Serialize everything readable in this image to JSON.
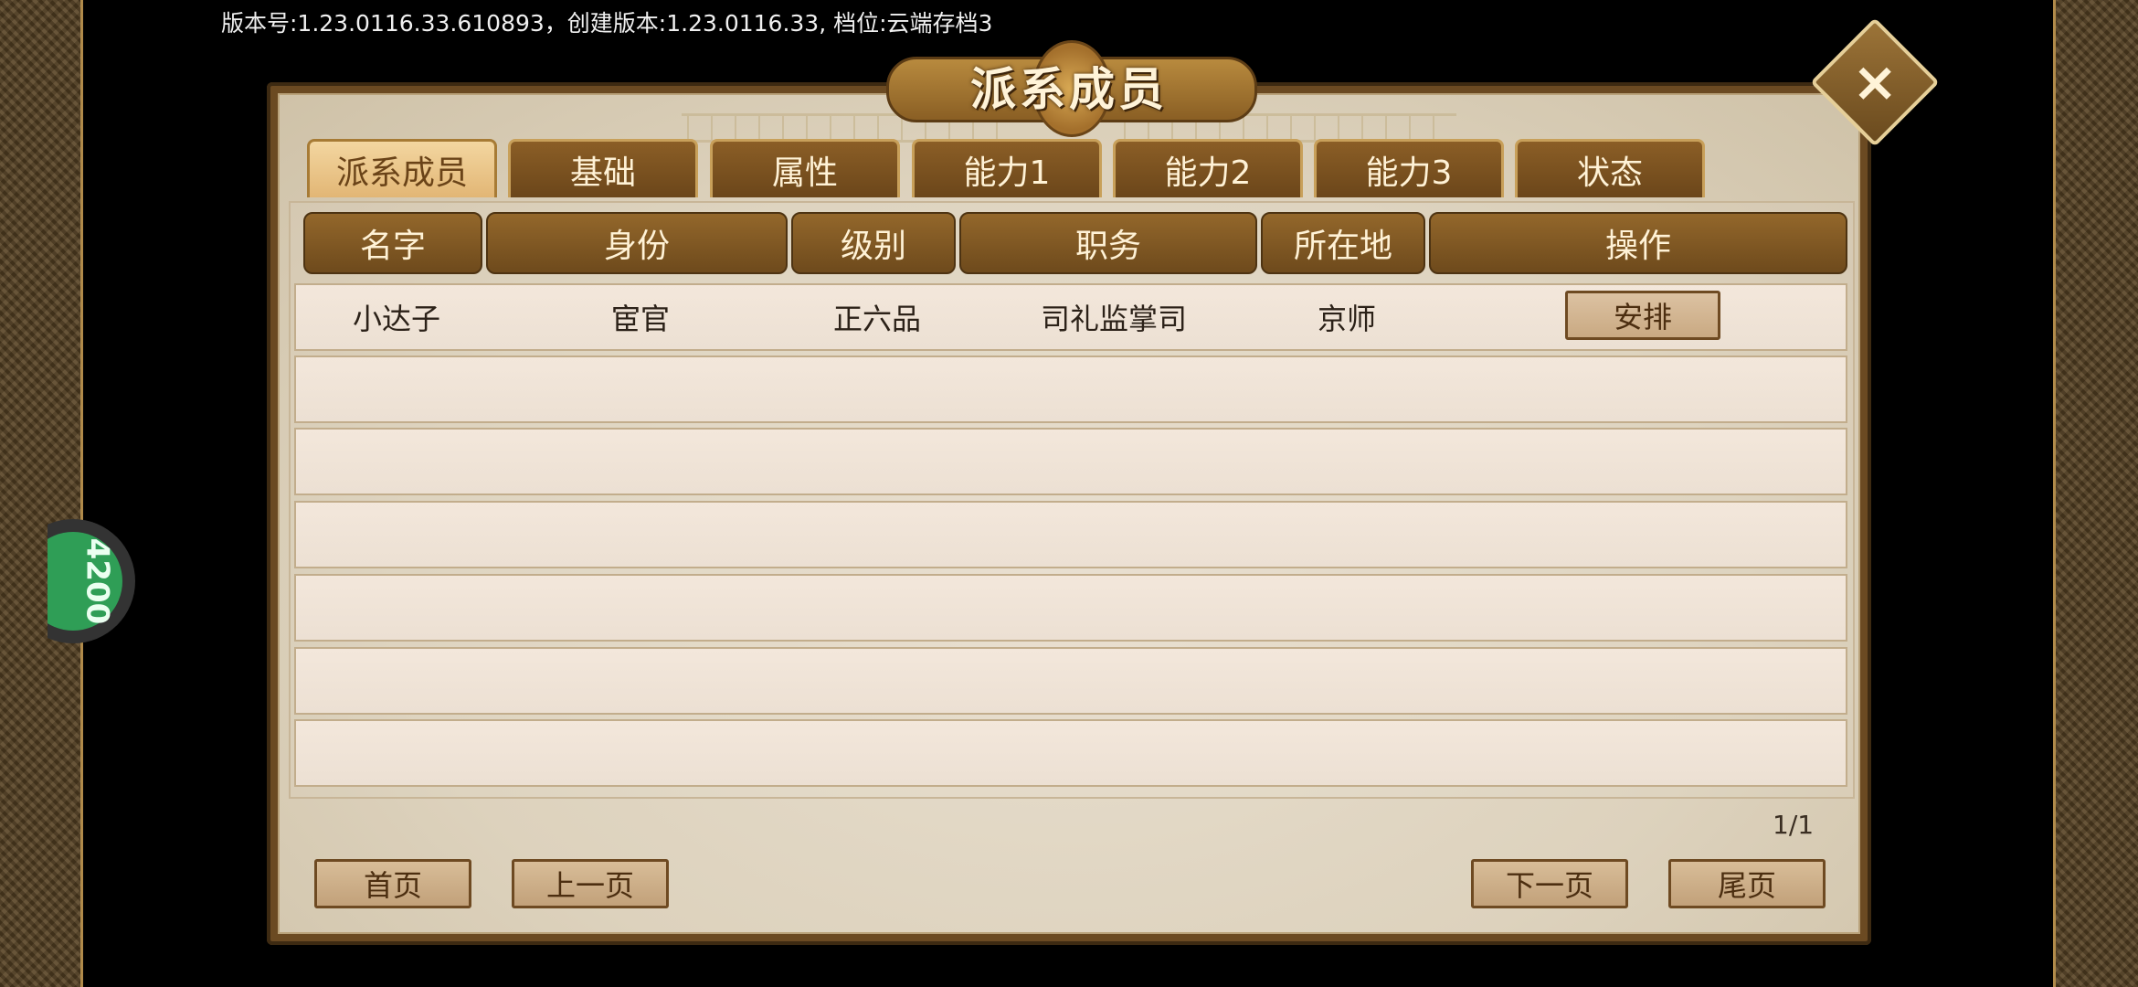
{
  "status_bar": {
    "version_text": "版本号:1.23.0116.33.610893，创建版本:1.23.0116.33, 档位:云端存档3"
  },
  "float_ball": {
    "number": "4200",
    "color": "#2f9e56"
  },
  "dialog": {
    "title": "派系成员",
    "close_icon": "close-x-icon",
    "tabs": [
      {
        "label": "派系成员",
        "active": true
      },
      {
        "label": "基础"
      },
      {
        "label": "属性"
      },
      {
        "label": "能力1"
      },
      {
        "label": "能力2"
      },
      {
        "label": "能力3"
      },
      {
        "label": "状态"
      }
    ],
    "columns": [
      "名字",
      "身份",
      "级别",
      "职务",
      "所在地",
      "操作"
    ],
    "rows": [
      {
        "name": "小达子",
        "identity": "宦官",
        "rank": "正六品",
        "post": "司礼监掌司",
        "location": "京师",
        "action": "安排"
      }
    ],
    "pager": {
      "page_text": "1/1",
      "first": "首页",
      "prev": "上一页",
      "next": "下一页",
      "last": "尾页"
    }
  },
  "colors": {
    "accent_brown": "#6b4a22",
    "active_tab": "#e2b675",
    "parchment": "#e8dfcf"
  }
}
